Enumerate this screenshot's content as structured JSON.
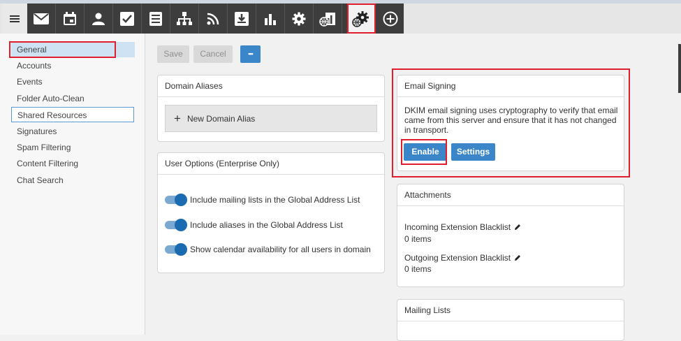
{
  "toolbar": {
    "icons": [
      "menu-icon",
      "mail-icon",
      "calendar-icon",
      "contacts-icon",
      "tasks-icon",
      "notes-icon",
      "org-chart-icon",
      "rss-icon",
      "download-icon",
      "reports-icon",
      "settings-icon",
      "domain-reports-icon",
      "domain-settings-icon",
      "add-icon"
    ],
    "active": "domain-settings-icon"
  },
  "sidebar": {
    "items": [
      {
        "label": "General"
      },
      {
        "label": "Accounts"
      },
      {
        "label": "Events"
      },
      {
        "label": "Folder Auto-Clean"
      },
      {
        "label": "Shared Resources"
      },
      {
        "label": "Signatures"
      },
      {
        "label": "Spam Filtering"
      },
      {
        "label": "Content Filtering"
      },
      {
        "label": "Chat Search"
      }
    ]
  },
  "actions": {
    "save_label": "Save",
    "cancel_label": "Cancel",
    "more_label": "•••"
  },
  "domain_aliases": {
    "title": "Domain Aliases",
    "new_label": "New Domain Alias"
  },
  "user_options": {
    "title": "User Options (Enterprise Only)",
    "toggles": [
      {
        "label": "Include mailing lists in the Global Address List",
        "on": true
      },
      {
        "label": "Include aliases in the Global Address List",
        "on": true
      },
      {
        "label": "Show calendar availability for all users in domain",
        "on": true
      }
    ]
  },
  "email_signing": {
    "title": "Email Signing",
    "description": "DKIM email signing uses cryptography to verify that email came from this server and ensure that it has not changed in transport.",
    "enable_label": "Enable",
    "settings_label": "Settings"
  },
  "attachments": {
    "title": "Attachments",
    "incoming_label": "Incoming Extension Blacklist",
    "incoming_count": "0 items",
    "outgoing_label": "Outgoing Extension Blacklist",
    "outgoing_count": "0 items"
  },
  "mailing_lists": {
    "title": "Mailing Lists"
  },
  "colors": {
    "accent": "#3a86c8",
    "highlight_red": "#e01e2d",
    "toolbar_dark": "#3d3d3d"
  }
}
